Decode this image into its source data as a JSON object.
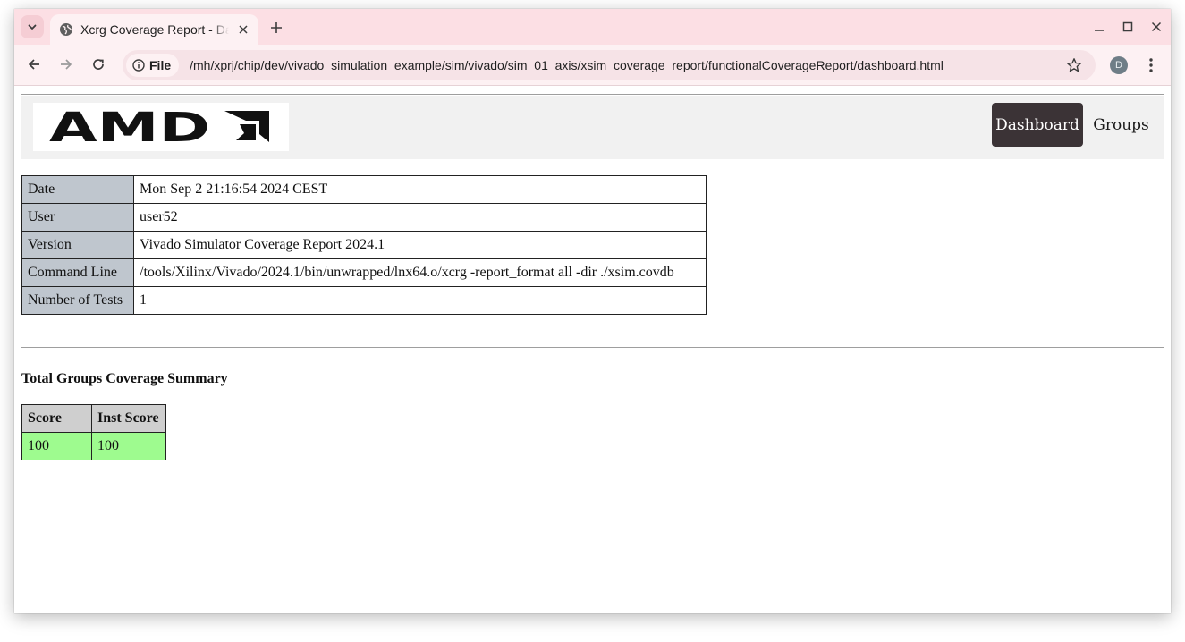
{
  "browser": {
    "tab_title": "Xcrg Coverage Report - Dashboard",
    "site_chip_label": "File",
    "url": "/mh/xprj/chip/dev/vivado_simulation_example/sim/vivado/sim_01_axis/xsim_coverage_report/functionalCoverageReport/dashboard.html",
    "profile_initial": "D"
  },
  "page": {
    "logo_text": "AMD",
    "nav": [
      {
        "label": "Dashboard",
        "active": true
      },
      {
        "label": "Groups",
        "active": false
      }
    ],
    "info": [
      {
        "key": "Date",
        "value": "Mon Sep 2 21:16:54 2024 CEST"
      },
      {
        "key": "User",
        "value": "user52"
      },
      {
        "key": "Version",
        "value": "Vivado Simulator Coverage Report 2024.1"
      },
      {
        "key": "Command Line",
        "value": "/tools/Xilinx/Vivado/2024.1/bin/unwrapped/lnx64.o/xcrg -report_format all -dir ./xsim.covdb"
      },
      {
        "key": "Number of Tests",
        "value": "1"
      }
    ],
    "summary": {
      "title": "Total Groups Coverage Summary",
      "headers": [
        "Score",
        "Inst Score"
      ],
      "row": [
        "100",
        "100"
      ],
      "pass_color": "#9efb8f"
    }
  },
  "colors": {
    "tabstrip": "#fcdfe4",
    "toolbar": "#fdf1f3",
    "navbar": "#f1f1f1",
    "nav_active": "#3b3336",
    "info_key_bg": "#bfc6ce",
    "summary_header_bg": "#cfcfcf"
  }
}
